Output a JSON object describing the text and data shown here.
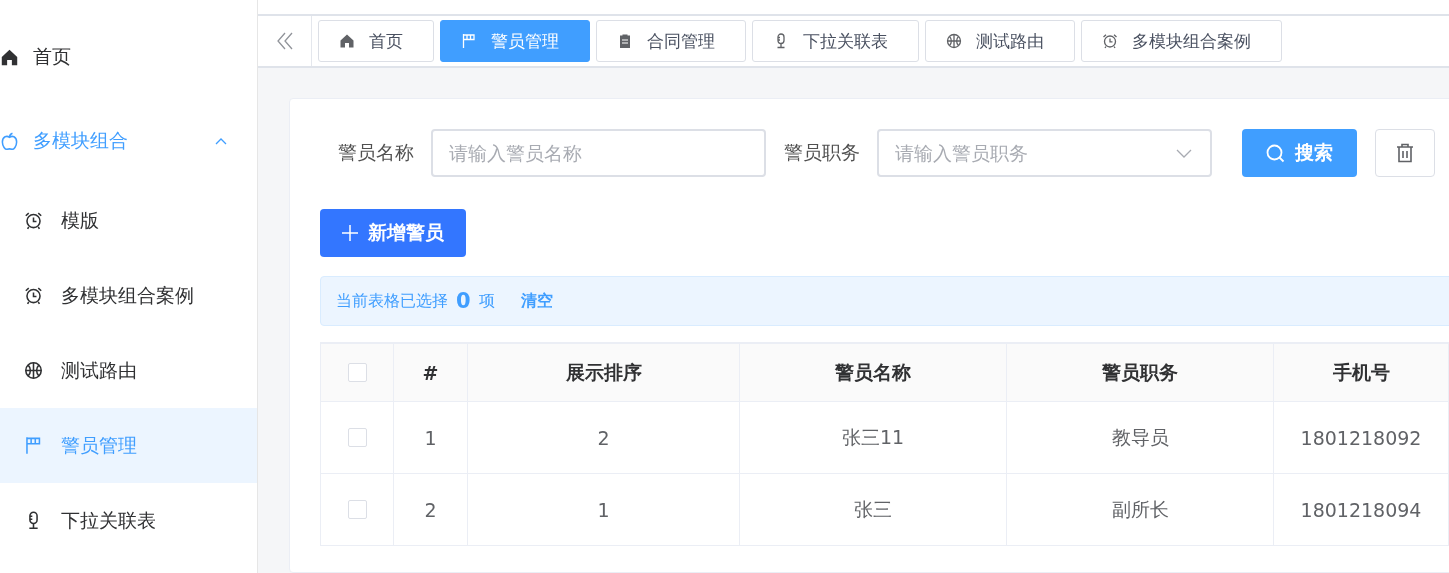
{
  "sidebar": {
    "items": [
      {
        "label": "首页",
        "selected": false
      },
      {
        "label": "多模块组合",
        "selected": false,
        "expanded": true,
        "children": [
          {
            "label": "模版",
            "selected": false
          },
          {
            "label": "多模块组合案例",
            "selected": false
          },
          {
            "label": "测试路由",
            "selected": false
          },
          {
            "label": "警员管理",
            "selected": true
          },
          {
            "label": "下拉关联表",
            "selected": false
          }
        ]
      }
    ]
  },
  "tabs": [
    {
      "label": "首页",
      "selected": false
    },
    {
      "label": "警员管理",
      "selected": true
    },
    {
      "label": "合同管理",
      "selected": false
    },
    {
      "label": "下拉关联表",
      "selected": false
    },
    {
      "label": "测试路由",
      "selected": false
    },
    {
      "label": "多模块组合案例",
      "selected": false
    }
  ],
  "search": {
    "name_label": "警员名称",
    "name_placeholder": "请输入警员名称",
    "duty_label": "警员职务",
    "duty_placeholder": "请输入警员职务",
    "search_button": "搜索"
  },
  "add_button": "新增警员",
  "selection_bar": {
    "prefix": "当前表格已选择",
    "count": "0",
    "suffix": "项",
    "clear": "清空"
  },
  "table": {
    "header_checked": false,
    "columns": [
      "#",
      "展示排序",
      "警员名称",
      "警员职务",
      "手机号"
    ],
    "rows": [
      {
        "selected": false,
        "cells": [
          "1",
          "2",
          "张三11",
          "教导员",
          "1801218092"
        ]
      },
      {
        "selected": false,
        "cells": [
          "2",
          "1",
          "张三",
          "副所长",
          "1801218094"
        ]
      }
    ]
  }
}
